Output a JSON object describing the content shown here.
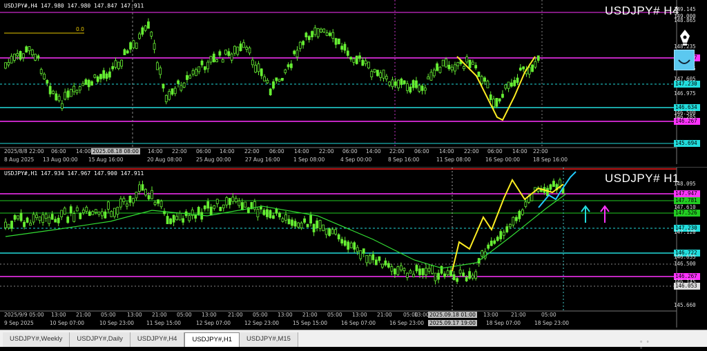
{
  "pane_h4": {
    "info": "USDJPY#,H4  147.980 147.980 147.847 147.911",
    "title": "USDJPY# H4",
    "level_label": "0.0",
    "price_boxes": [
      {
        "price": "147.947",
        "color": "#ff33ff"
      },
      {
        "price": "147.230",
        "color": "#22dddd"
      },
      {
        "price": "146.634",
        "color": "#22dddd"
      },
      {
        "price": "146.267",
        "color": "#ff33ff"
      },
      {
        "price": "145.694",
        "color": "#22dddd"
      }
    ],
    "price_ticks": [
      "149.145",
      "149.000",
      "148.865",
      "148.235",
      "147.925",
      "147.605",
      "146.975",
      "146.500",
      "146.285"
    ],
    "time_labels": [
      "2025/8/8 22:00",
      "06:00",
      "14:00",
      "2025.08.18 08:00",
      "14:00",
      "22:00",
      "06:00",
      "14:00",
      "22:00",
      "06:00",
      "14:00",
      "22:00",
      "06:00",
      "14:00",
      "22:00",
      "06:00",
      "14:00",
      "22:00",
      "06:00",
      "14:00",
      "22:00"
    ],
    "date_labels": [
      "8 Aug 2025",
      "13 Aug 00:00",
      "15 Aug 16:00",
      "20 Aug 08:00",
      "25 Aug 00:00",
      "27 Aug 16:00",
      "1 Sep 08:00",
      "4 Sep 00:00",
      "8 Sep 16:00",
      "11 Sep 08:00",
      "16 Sep 00:00",
      "18 Sep 16:00"
    ]
  },
  "pane_h1": {
    "info": "USDJPY#,H1  147.934 147.967 147.900 147.911",
    "title": "USDJPY# H1",
    "price_boxes": [
      {
        "price": "147.947",
        "color": "#ff33ff"
      },
      {
        "price": "147.781",
        "color": "#22cc22"
      },
      {
        "price": "147.526",
        "color": "#22cc22"
      },
      {
        "price": "147.230",
        "color": "#22dddd"
      },
      {
        "price": "146.722",
        "color": "#22dddd"
      },
      {
        "price": "146.267",
        "color": "#ff33ff"
      },
      {
        "price": "146.053",
        "color": "#dddddd"
      }
    ],
    "price_ticks": [
      "148.095",
      "147.610",
      "147.120",
      "146.635",
      "146.500",
      "146.145",
      "145.660"
    ],
    "time_labels": [
      "2025/9/9 05:00",
      "13:00",
      "21:00",
      "05:00",
      "13:00",
      "21:00",
      "05:00",
      "13:00",
      "21:00",
      "05:00",
      "13:00",
      "21:00",
      "05:00",
      "13:00",
      "21:00",
      "05:00",
      "13:00",
      "2025.09.18 01:00",
      "13:00",
      "21:00",
      "05:00"
    ],
    "date_labels": [
      "9 Sep 2025",
      "10 Sep 07:00",
      "10 Sep 23:00",
      "11 Sep 15:00",
      "12 Sep 07:00",
      "12 Sep 23:00",
      "15 Sep 15:00",
      "16 Sep 07:00",
      "16 Sep 23:00",
      "2025.09.17 19:00",
      "18 Sep 07:00",
      "18 Sep 23:00"
    ]
  },
  "tabs": [
    "USDJPY#,Weekly",
    "USDJPY#,Daily",
    "USDJPY#,H4",
    "USDJPY#,H1",
    "USDJPY#,M15"
  ],
  "active_tab": "USDJPY#,H1",
  "colors": {
    "magenta": "#ff33ff",
    "cyan": "#22dddd",
    "green": "#22cc22",
    "candle": "#66ee33",
    "yellow": "#ffee22",
    "ma": "#33dd33"
  }
}
